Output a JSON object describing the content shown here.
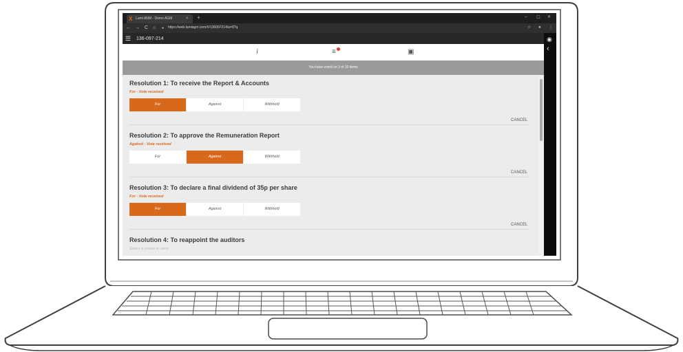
{
  "browser": {
    "tab_title": "Lumi ANM - Demo AGM",
    "tab_logo": "X",
    "close_tab": "×",
    "new_tab": "+",
    "minimize": "–",
    "maximize": "▢",
    "close_window": "✕",
    "back": "←",
    "forward": "→",
    "reload": "C",
    "home": "⌂",
    "secure_dot": "●",
    "url": "https://web.lumiagm.com/#/136097214/a=8?q",
    "bookmark": "☆",
    "menu": "⋮",
    "profile": "●"
  },
  "app": {
    "menu_icon": "hamburger-icon",
    "meeting_id": "136-097-214",
    "icons": [
      {
        "name": "info-icon",
        "glyph": "i"
      },
      {
        "name": "voting-icon",
        "glyph": "≡"
      },
      {
        "name": "media-icon",
        "glyph": "▣"
      }
    ],
    "status_message": "You have voted on 3 of 10 items",
    "accent_color": "#d9691a"
  },
  "side_panel": {
    "broadcast_glyph": "◉",
    "collapse_glyph": "‹"
  },
  "options": {
    "for": "For",
    "against": "Against",
    "withheld": "Withheld"
  },
  "cancel_label": "CANCEL",
  "resolutions": [
    {
      "title": "Resolution 1: To receive the Report & Accounts",
      "status": "For - Vote received",
      "selected": "for"
    },
    {
      "title": "Resolution 2: To approve the Remuneration Report",
      "status": "Against - Vote received",
      "selected": "against"
    },
    {
      "title": "Resolution 3: To declare a final dividend of 35p per share",
      "status": "For - Vote received",
      "selected": "for"
    },
    {
      "title": "Resolution 4: To reappoint the auditors",
      "prompt": "Select a choice to send"
    }
  ]
}
